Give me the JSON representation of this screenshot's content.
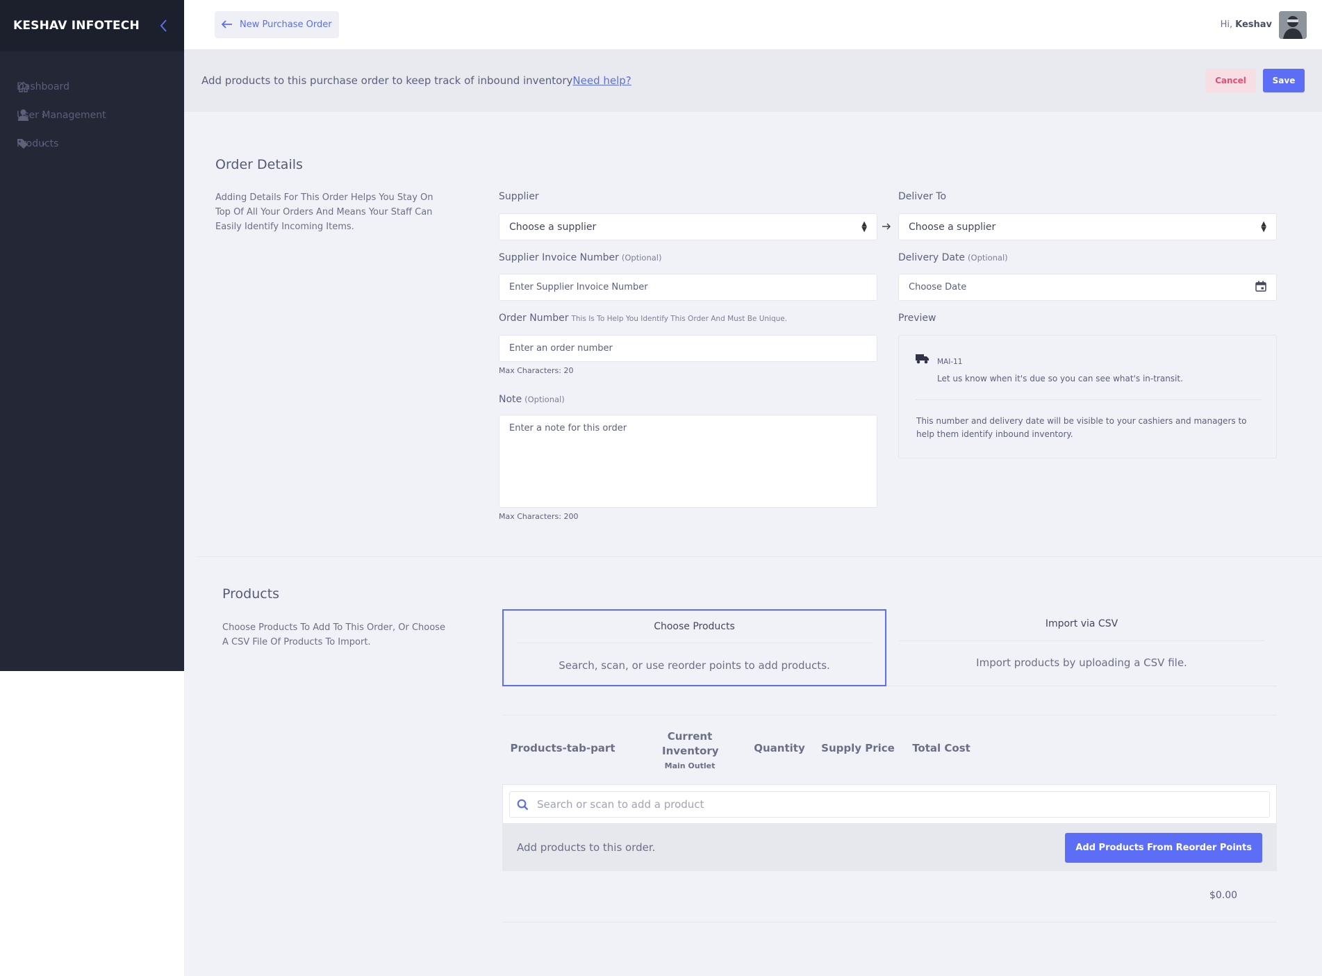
{
  "sidebar": {
    "brand": "KESHAV INFOTECH",
    "items": [
      {
        "label": "Dashboard",
        "icon": "home-icon"
      },
      {
        "label": "User Management",
        "icon": "user-icon"
      },
      {
        "label": "Products",
        "icon": "tag-icon"
      }
    ]
  },
  "topbar": {
    "back_label": "New Purchase Order",
    "greeting": "Hi,",
    "user_name": "Keshav"
  },
  "infobar": {
    "text": "Add products to this purchase order to keep track of inbound inventory",
    "help_link": "Need help?",
    "cancel_label": "Cancel",
    "save_label": "Save"
  },
  "order_details": {
    "title": "Order Details",
    "description": "Adding Details For This Order Helps You Stay On Top Of All Your Orders And Means Your Staff Can Easily Identify Incoming Items.",
    "supplier_label": "Supplier",
    "supplier_value": "Choose a supplier",
    "deliver_to_label": "Deliver To",
    "deliver_to_value": "Choose a supplier",
    "invoice_label": "Supplier Invoice Number",
    "invoice_optional": "(Optional)",
    "invoice_placeholder": "Enter Supplier Invoice Number",
    "delivery_date_label": "Delivery Date",
    "delivery_date_optional": "(Optional)",
    "delivery_date_placeholder": "Choose Date",
    "order_number_label": "Order Number",
    "order_number_hint": "This Is To Help You Identify This Order And Must Be Unique.",
    "order_number_placeholder": "Enter an order number",
    "order_number_max": "Max Characters: 20",
    "note_label": "Note",
    "note_optional": "(Optional)",
    "note_placeholder": "Enter a note for this order",
    "note_max": "Max Characters: 200",
    "preview_label": "Preview",
    "preview_code": "MAI-11",
    "preview_text": "Let us know when it's due so you can see what's in-transit.",
    "preview_note": "This number and delivery date will be visible to your cashiers and managers to help them identify inbound inventory."
  },
  "products": {
    "title": "Products",
    "description": "Choose Products To Add To This Order, Or Choose A CSV File Of Products To Import.",
    "tabs": [
      {
        "title": "Choose Products",
        "desc": "Search, scan, or use reorder points to add products."
      },
      {
        "title": "Import via CSV",
        "desc": "Import products by uploading a CSV file."
      }
    ],
    "columns": {
      "name": "Products-tab-part",
      "inventory": "Current Inventory",
      "inventory_sub": "Main Outlet",
      "quantity": "Quantity",
      "supply_price": "Supply Price",
      "total_cost": "Total Cost"
    },
    "search_placeholder": "Search or scan to add a product",
    "empty_text": "Add products to this order.",
    "reorder_button": "Add Products From Reorder Points",
    "total": "$0.00"
  },
  "colors": {
    "accent": "#5b6ef5",
    "sidebar": "#232736",
    "cancel": "#e2507a"
  }
}
